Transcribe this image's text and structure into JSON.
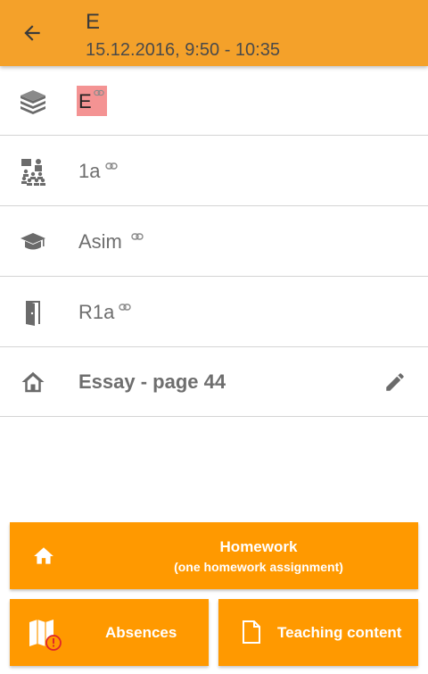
{
  "header": {
    "title": "E",
    "datetime": "15.12.2016, 9:50 - 10:35"
  },
  "details": {
    "subject": "E",
    "class": "1a",
    "teacher": "Asim",
    "room": "R1a",
    "homework": "Essay - page 44"
  },
  "actions": {
    "homework_title": "Homework",
    "homework_subtitle": "(one homework assignment)",
    "absences_label": "Absences",
    "teaching_content_label": "Teaching content"
  },
  "icons": {
    "back": "arrow-left",
    "subject": "books",
    "class": "classroom",
    "teacher": "graduation-cap",
    "room": "door",
    "homework": "home",
    "edit": "pencil",
    "link": "link",
    "absences": "map-with-alert",
    "teaching_content": "document"
  },
  "colors": {
    "appbar": "#f4a12a",
    "button": "#ff9900",
    "subject_chip": "#f49393"
  }
}
